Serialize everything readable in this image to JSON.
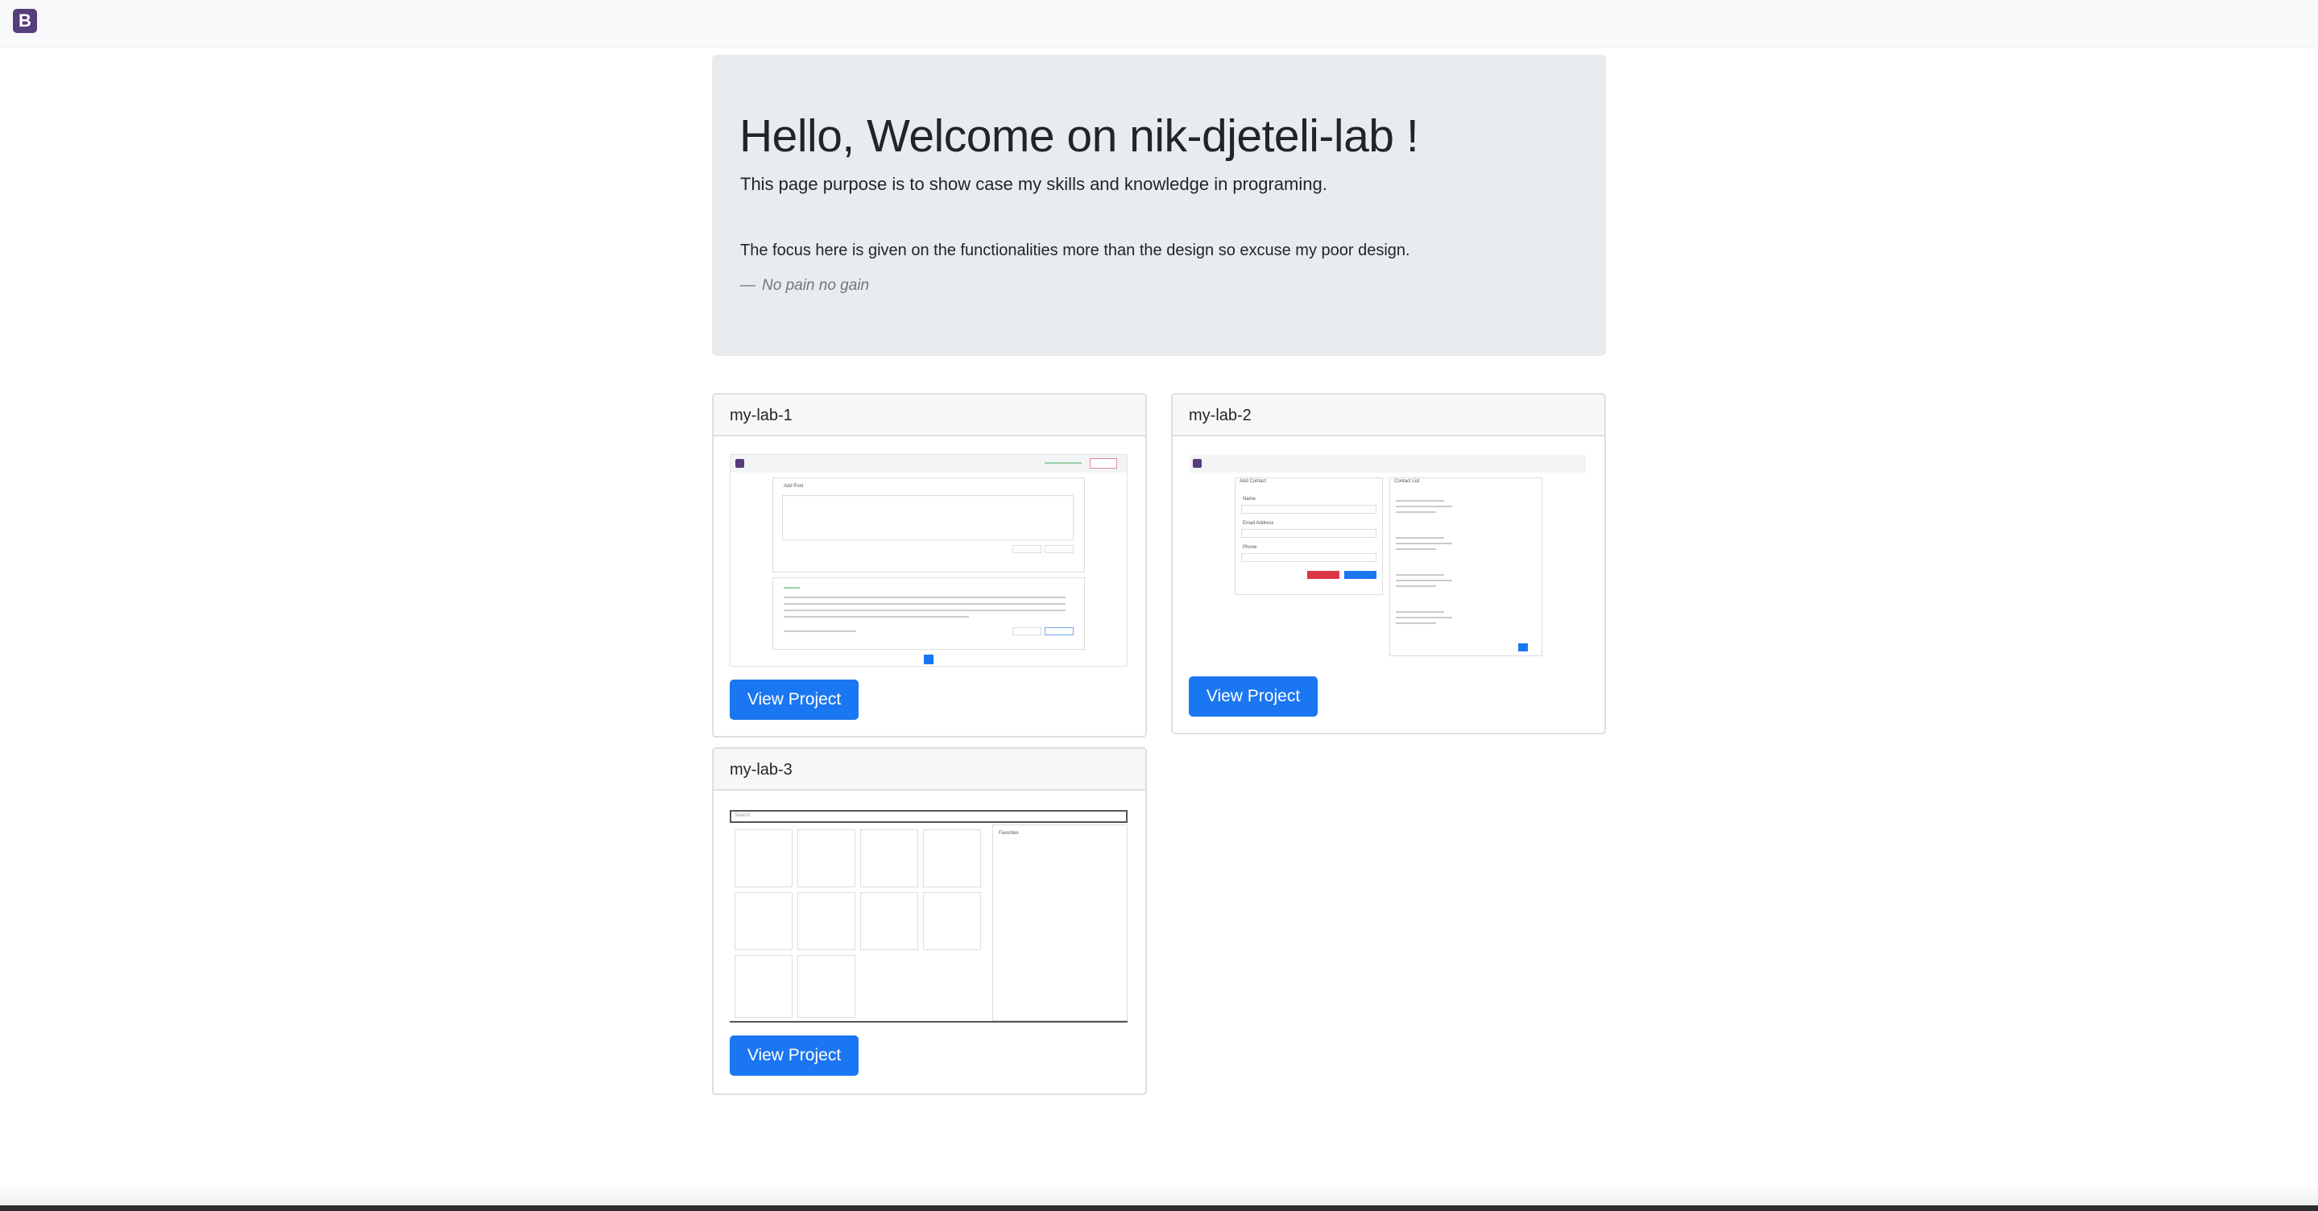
{
  "navbar": {
    "brand_glyph": "B",
    "brand_color": "#563d7c"
  },
  "jumbotron": {
    "title": "Hello, Welcome on nik-djeteli-lab !",
    "lead": "This page purpose is to show case my skills and knowledge in programing.",
    "quote": "The focus here is given on the functionalities more than the design so excuse my poor design.",
    "footer_dash": "—",
    "footer_cite": "No pain no gain"
  },
  "projects": [
    {
      "name": "my-lab-1",
      "button_label": "View Project"
    },
    {
      "name": "my-lab-2",
      "button_label": "View Project"
    },
    {
      "name": "my-lab-3",
      "button_label": "View Project"
    }
  ],
  "thumbnails": {
    "lab1": {
      "add_post": "Add Post"
    },
    "lab2": {
      "add_contact": "Add Contact",
      "contact_list": "Contact List",
      "name_label": "Name",
      "email_label": "Email Address",
      "phone_label": "Phone"
    },
    "lab3": {
      "search_placeholder": "Search",
      "favorites": "Favorites"
    }
  },
  "colors": {
    "primary": "#1b76f1",
    "jumbotron_bg": "#e9ecef",
    "card_border": "#dcdfe2"
  }
}
